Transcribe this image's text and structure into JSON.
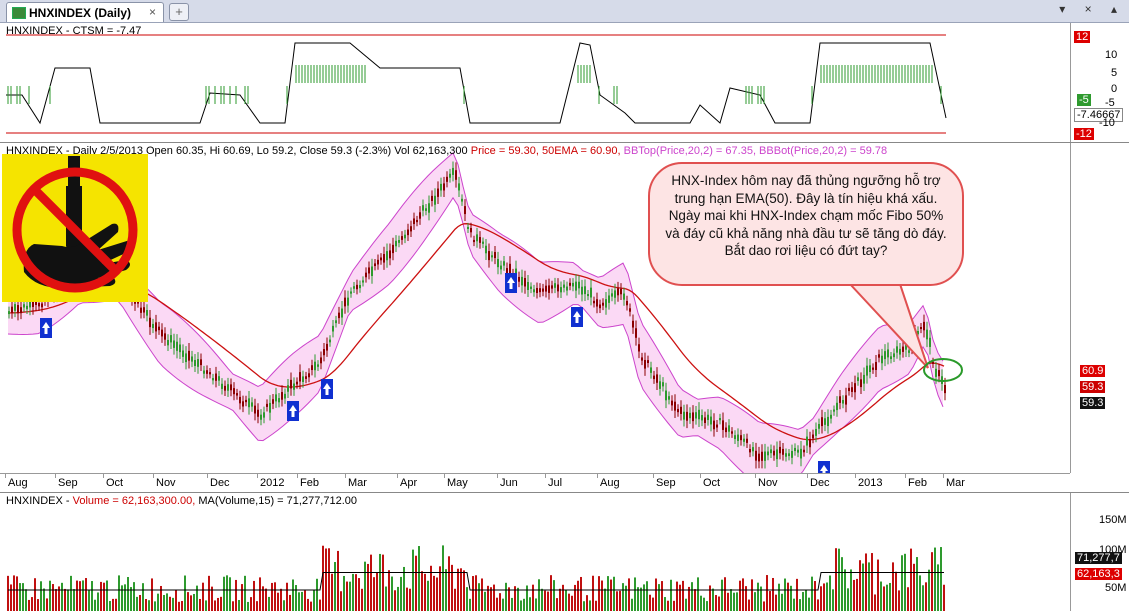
{
  "tab": {
    "title": "HNXINDEX (Daily)",
    "close": "×",
    "new_tab": "+"
  },
  "window_buttons": "▾ × ▴",
  "indicator_pane": {
    "title": "HNXINDEX - CTSM = -7.47",
    "y_ticks": [
      "10",
      "5",
      "0",
      "-5",
      "-10"
    ],
    "badges": {
      "top": "12",
      "green": "-5",
      "value": "-7.46667",
      "bottom": "-12"
    },
    "colors": {
      "bars": "#2e9a2e",
      "line": "#000000",
      "bands": "#cc0000"
    }
  },
  "price_pane": {
    "title_parts": {
      "symbol": "HNXINDEX - Daily 2/5/2013 Open 60.35, Hi 60.69, Lo 59.2, Close 59.3 (-2.3%) Vol 62,163,300",
      "price": " Price = 59.30,",
      "ema": " 50EMA = 60.90,",
      "bbtop": " BBTop(Price,20,2) = 67.35,",
      "bbbot": " BBBot(Price,20,2) = 59.78"
    },
    "badges": {
      "ema": "60.9",
      "price1": "59.3",
      "price2": "59.3"
    },
    "callout": "HNX-Index hôm nay đã thủng ngưỡng hỗ trợ trung hạn EMA(50). Đây là tín hiệu khá xấu. Ngày mai khi HNX-Index chạm mốc Fibo 50% và đáy cũ khả năng nhà đầu tư sẽ tăng dò đáy. Bắt dao rơi liệu có đứt tay?",
    "colors": {
      "up": "#2e9a2e",
      "down": "#8b0000",
      "ema": "#cc1111",
      "bands": "#cc44cc",
      "band_fill": "#fbd9f5",
      "arrow": "#1030d0"
    }
  },
  "x_axis": [
    "Aug",
    "Sep",
    "Oct",
    "Nov",
    "Dec",
    "2012",
    "Feb",
    "Mar",
    "Apr",
    "May",
    "Jun",
    "Jul",
    "Aug",
    "Sep",
    "Oct",
    "Nov",
    "Dec",
    "2013",
    "Feb",
    "Mar"
  ],
  "volume_pane": {
    "title_parts": {
      "symbol": "HNXINDEX - ",
      "vol": "Volume = 62,163,300.00,",
      "ma": " MA(Volume,15) = 71,277,712.00"
    },
    "y_ticks": [
      "150M",
      "100M",
      "50M"
    ],
    "badges": {
      "ma": "71,277,7",
      "vol": "62,163,3"
    }
  }
}
